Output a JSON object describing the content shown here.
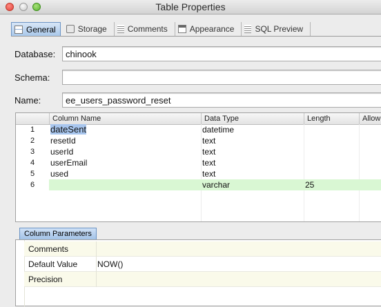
{
  "window": {
    "title": "Table Properties"
  },
  "tabs": [
    {
      "label": "General",
      "icon": "table-icon",
      "active": true
    },
    {
      "label": "Storage",
      "icon": "storage-icon",
      "active": false
    },
    {
      "label": "Comments",
      "icon": "comments-icon",
      "active": false
    },
    {
      "label": "Appearance",
      "icon": "appearance-icon",
      "active": false
    },
    {
      "label": "SQL Preview",
      "icon": "sql-preview-icon",
      "active": false
    }
  ],
  "form": {
    "database_label": "Database:",
    "database_value": "chinook",
    "schema_label": "Schema:",
    "schema_value": "",
    "name_label": "Name:",
    "name_value": "ee_users_password_reset"
  },
  "columns_table": {
    "headers": [
      "Column Name",
      "Data Type",
      "Length",
      "Allow"
    ],
    "rows": [
      {
        "num": "1",
        "name": "dateSent",
        "type": "datetime",
        "length": "",
        "selected": true
      },
      {
        "num": "2",
        "name": "resetId",
        "type": "text",
        "length": ""
      },
      {
        "num": "3",
        "name": "userId",
        "type": "text",
        "length": ""
      },
      {
        "num": "4",
        "name": "userEmail",
        "type": "text",
        "length": ""
      },
      {
        "num": "5",
        "name": "used",
        "type": "text",
        "length": ""
      },
      {
        "num": "6",
        "name": "",
        "type": "varchar",
        "length": "25",
        "new": true
      }
    ]
  },
  "column_parameters": {
    "tab_label": "Column Parameters",
    "rows": [
      {
        "name": "Comments",
        "value": ""
      },
      {
        "name": "Default Value",
        "value": "NOW()"
      },
      {
        "name": "Precision",
        "value": ""
      }
    ]
  },
  "colors": {
    "selection": "#a8c6ee",
    "new_row": "#d9f7d3",
    "tab_active": "#a9c8ea"
  }
}
